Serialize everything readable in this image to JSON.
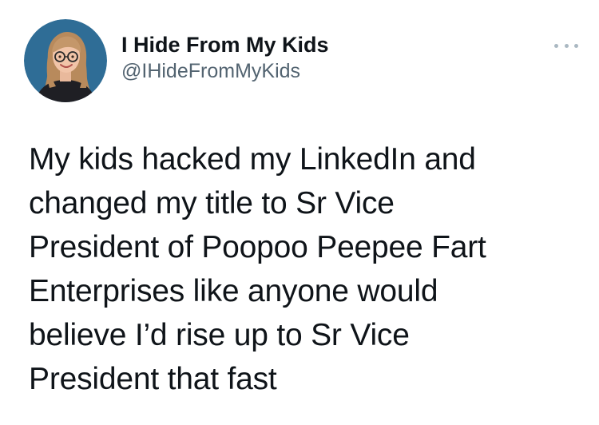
{
  "author": {
    "display_name": "I Hide From My Kids",
    "handle": "@IHideFromMyKids"
  },
  "tweet": {
    "lines": [
      "My kids hacked my LinkedIn and",
      "changed my title to Sr Vice",
      "President of Poopoo Peepee Fart",
      "Enterprises like anyone would",
      "believe I’d rise up to Sr Vice",
      "President that fast"
    ]
  },
  "icons": {
    "more": "more-options-icon",
    "avatar": "profile-avatar"
  },
  "colors": {
    "avatar_bg": "#2f6d96",
    "muted": "#536471",
    "text": "#0f1419"
  }
}
